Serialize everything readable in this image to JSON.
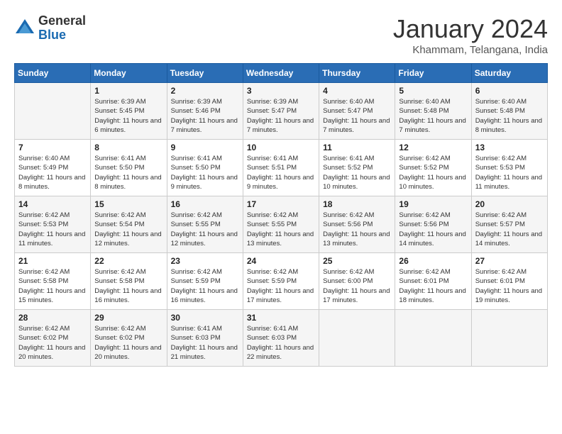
{
  "header": {
    "logo_general": "General",
    "logo_blue": "Blue",
    "month_year": "January 2024",
    "location": "Khammam, Telangana, India"
  },
  "columns": [
    "Sunday",
    "Monday",
    "Tuesday",
    "Wednesday",
    "Thursday",
    "Friday",
    "Saturday"
  ],
  "weeks": [
    [
      {
        "day": "",
        "sunrise": "",
        "sunset": "",
        "daylight": ""
      },
      {
        "day": "1",
        "sunrise": "Sunrise: 6:39 AM",
        "sunset": "Sunset: 5:45 PM",
        "daylight": "Daylight: 11 hours and 6 minutes."
      },
      {
        "day": "2",
        "sunrise": "Sunrise: 6:39 AM",
        "sunset": "Sunset: 5:46 PM",
        "daylight": "Daylight: 11 hours and 7 minutes."
      },
      {
        "day": "3",
        "sunrise": "Sunrise: 6:39 AM",
        "sunset": "Sunset: 5:47 PM",
        "daylight": "Daylight: 11 hours and 7 minutes."
      },
      {
        "day": "4",
        "sunrise": "Sunrise: 6:40 AM",
        "sunset": "Sunset: 5:47 PM",
        "daylight": "Daylight: 11 hours and 7 minutes."
      },
      {
        "day": "5",
        "sunrise": "Sunrise: 6:40 AM",
        "sunset": "Sunset: 5:48 PM",
        "daylight": "Daylight: 11 hours and 7 minutes."
      },
      {
        "day": "6",
        "sunrise": "Sunrise: 6:40 AM",
        "sunset": "Sunset: 5:48 PM",
        "daylight": "Daylight: 11 hours and 8 minutes."
      }
    ],
    [
      {
        "day": "7",
        "sunrise": "Sunrise: 6:40 AM",
        "sunset": "Sunset: 5:49 PM",
        "daylight": "Daylight: 11 hours and 8 minutes."
      },
      {
        "day": "8",
        "sunrise": "Sunrise: 6:41 AM",
        "sunset": "Sunset: 5:50 PM",
        "daylight": "Daylight: 11 hours and 8 minutes."
      },
      {
        "day": "9",
        "sunrise": "Sunrise: 6:41 AM",
        "sunset": "Sunset: 5:50 PM",
        "daylight": "Daylight: 11 hours and 9 minutes."
      },
      {
        "day": "10",
        "sunrise": "Sunrise: 6:41 AM",
        "sunset": "Sunset: 5:51 PM",
        "daylight": "Daylight: 11 hours and 9 minutes."
      },
      {
        "day": "11",
        "sunrise": "Sunrise: 6:41 AM",
        "sunset": "Sunset: 5:52 PM",
        "daylight": "Daylight: 11 hours and 10 minutes."
      },
      {
        "day": "12",
        "sunrise": "Sunrise: 6:42 AM",
        "sunset": "Sunset: 5:52 PM",
        "daylight": "Daylight: 11 hours and 10 minutes."
      },
      {
        "day": "13",
        "sunrise": "Sunrise: 6:42 AM",
        "sunset": "Sunset: 5:53 PM",
        "daylight": "Daylight: 11 hours and 11 minutes."
      }
    ],
    [
      {
        "day": "14",
        "sunrise": "Sunrise: 6:42 AM",
        "sunset": "Sunset: 5:53 PM",
        "daylight": "Daylight: 11 hours and 11 minutes."
      },
      {
        "day": "15",
        "sunrise": "Sunrise: 6:42 AM",
        "sunset": "Sunset: 5:54 PM",
        "daylight": "Daylight: 11 hours and 12 minutes."
      },
      {
        "day": "16",
        "sunrise": "Sunrise: 6:42 AM",
        "sunset": "Sunset: 5:55 PM",
        "daylight": "Daylight: 11 hours and 12 minutes."
      },
      {
        "day": "17",
        "sunrise": "Sunrise: 6:42 AM",
        "sunset": "Sunset: 5:55 PM",
        "daylight": "Daylight: 11 hours and 13 minutes."
      },
      {
        "day": "18",
        "sunrise": "Sunrise: 6:42 AM",
        "sunset": "Sunset: 5:56 PM",
        "daylight": "Daylight: 11 hours and 13 minutes."
      },
      {
        "day": "19",
        "sunrise": "Sunrise: 6:42 AM",
        "sunset": "Sunset: 5:56 PM",
        "daylight": "Daylight: 11 hours and 14 minutes."
      },
      {
        "day": "20",
        "sunrise": "Sunrise: 6:42 AM",
        "sunset": "Sunset: 5:57 PM",
        "daylight": "Daylight: 11 hours and 14 minutes."
      }
    ],
    [
      {
        "day": "21",
        "sunrise": "Sunrise: 6:42 AM",
        "sunset": "Sunset: 5:58 PM",
        "daylight": "Daylight: 11 hours and 15 minutes."
      },
      {
        "day": "22",
        "sunrise": "Sunrise: 6:42 AM",
        "sunset": "Sunset: 5:58 PM",
        "daylight": "Daylight: 11 hours and 16 minutes."
      },
      {
        "day": "23",
        "sunrise": "Sunrise: 6:42 AM",
        "sunset": "Sunset: 5:59 PM",
        "daylight": "Daylight: 11 hours and 16 minutes."
      },
      {
        "day": "24",
        "sunrise": "Sunrise: 6:42 AM",
        "sunset": "Sunset: 5:59 PM",
        "daylight": "Daylight: 11 hours and 17 minutes."
      },
      {
        "day": "25",
        "sunrise": "Sunrise: 6:42 AM",
        "sunset": "Sunset: 6:00 PM",
        "daylight": "Daylight: 11 hours and 17 minutes."
      },
      {
        "day": "26",
        "sunrise": "Sunrise: 6:42 AM",
        "sunset": "Sunset: 6:01 PM",
        "daylight": "Daylight: 11 hours and 18 minutes."
      },
      {
        "day": "27",
        "sunrise": "Sunrise: 6:42 AM",
        "sunset": "Sunset: 6:01 PM",
        "daylight": "Daylight: 11 hours and 19 minutes."
      }
    ],
    [
      {
        "day": "28",
        "sunrise": "Sunrise: 6:42 AM",
        "sunset": "Sunset: 6:02 PM",
        "daylight": "Daylight: 11 hours and 20 minutes."
      },
      {
        "day": "29",
        "sunrise": "Sunrise: 6:42 AM",
        "sunset": "Sunset: 6:02 PM",
        "daylight": "Daylight: 11 hours and 20 minutes."
      },
      {
        "day": "30",
        "sunrise": "Sunrise: 6:41 AM",
        "sunset": "Sunset: 6:03 PM",
        "daylight": "Daylight: 11 hours and 21 minutes."
      },
      {
        "day": "31",
        "sunrise": "Sunrise: 6:41 AM",
        "sunset": "Sunset: 6:03 PM",
        "daylight": "Daylight: 11 hours and 22 minutes."
      },
      {
        "day": "",
        "sunrise": "",
        "sunset": "",
        "daylight": ""
      },
      {
        "day": "",
        "sunrise": "",
        "sunset": "",
        "daylight": ""
      },
      {
        "day": "",
        "sunrise": "",
        "sunset": "",
        "daylight": ""
      }
    ]
  ]
}
